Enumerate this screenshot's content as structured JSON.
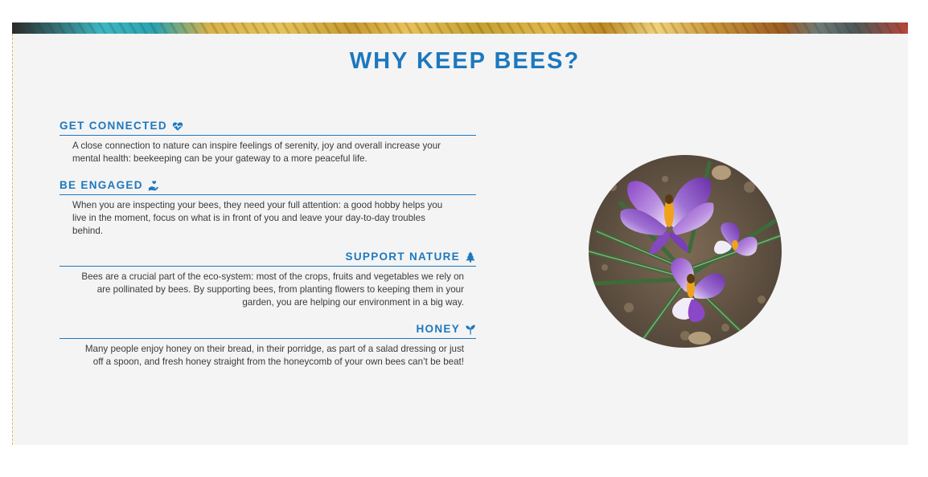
{
  "section": {
    "title": "WHY KEEP BEES?"
  },
  "items": [
    {
      "heading": "GET CONNECTED",
      "icon": "heartbeat-icon",
      "text": "A close connection to nature can inspire feelings of serenity, joy and overall increase your mental health: beekeeping can be your gateway to a more peaceful life."
    },
    {
      "heading": "BE ENGAGED",
      "icon": "hand-holding-heart-icon",
      "text": "When you are inspecting your bees, they need your full attention: a good hobby helps you live in the moment, focus on what is in front of you and leave your day-to-day troubles behind."
    },
    {
      "heading": "SUPPORT NATURE",
      "icon": "tree-icon",
      "text": "Bees are a crucial part of the eco-system: most of the crops, fruits and vegetables we rely on are pollinated by bees. By supporting bees, from planting flowers to keeping them in your garden, you are helping our environment in a big way."
    },
    {
      "heading": "HONEY",
      "icon": "seedling-icon",
      "text": "Many people enjoy honey on their bread, in their porridge, as part of a salad dressing or just off a spoon, and fresh honey straight from the honeycomb of your own bees can’t be beat!"
    }
  ],
  "image": {
    "subject": "purple crocus flowers with bees",
    "colors": {
      "accent": "#1d78be",
      "petal": "#7a3fb8",
      "petal_light": "#f1ecf7",
      "stamen": "#f0a21c",
      "leaf": "#3d6b3a",
      "soil": "#6b5a48"
    }
  }
}
